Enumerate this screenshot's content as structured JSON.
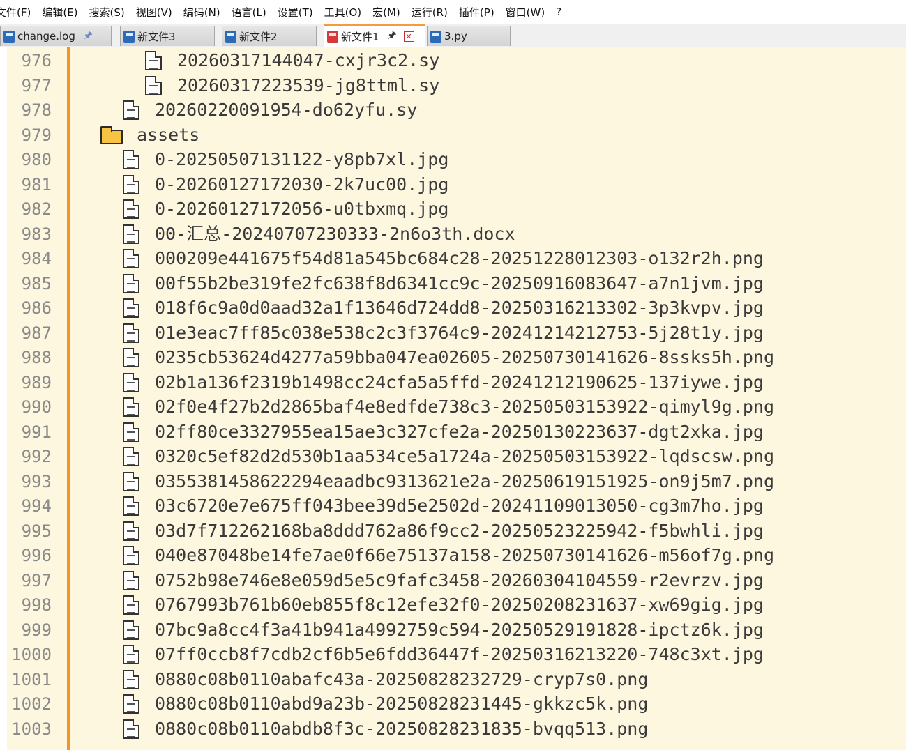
{
  "menu": [
    "文件(F)",
    "编辑(E)",
    "搜索(S)",
    "视图(V)",
    "编码(N)",
    "语言(L)",
    "设置(T)",
    "工具(O)",
    "宏(M)",
    "运行(R)",
    "插件(P)",
    "窗口(W)",
    "?"
  ],
  "tabs": [
    {
      "label": "change.log",
      "active": false
    },
    {
      "label": "新文件3",
      "active": false
    },
    {
      "label": "新文件2",
      "active": false
    },
    {
      "label": "新文件1",
      "active": true
    },
    {
      "label": "3.py",
      "active": false
    }
  ],
  "lines": [
    {
      "number": "976",
      "kind": "file",
      "depth": 3,
      "text": "20260317144047-cxjr3c2.sy"
    },
    {
      "number": "977",
      "kind": "file",
      "depth": 3,
      "text": "20260317223539-jg8ttml.sy"
    },
    {
      "number": "978",
      "kind": "file",
      "depth": 2,
      "text": "20260220091954-do62yfu.sy"
    },
    {
      "number": "979",
      "kind": "folder",
      "depth": 1,
      "text": "assets"
    },
    {
      "number": "980",
      "kind": "file",
      "depth": 2,
      "text": "0-20250507131122-y8pb7xl.jpg"
    },
    {
      "number": "981",
      "kind": "file",
      "depth": 2,
      "text": "0-20260127172030-2k7uc00.jpg"
    },
    {
      "number": "982",
      "kind": "file",
      "depth": 2,
      "text": "0-20260127172056-u0tbxmq.jpg"
    },
    {
      "number": "983",
      "kind": "file",
      "depth": 2,
      "text": "00-汇总-20240707230333-2n6o3th.docx"
    },
    {
      "number": "984",
      "kind": "file",
      "depth": 2,
      "text": "000209e441675f54d81a545bc684c28-20251228012303-o132r2h.png"
    },
    {
      "number": "985",
      "kind": "file",
      "depth": 2,
      "text": "00f55b2be319fe2fc638f8d6341cc9c-20250916083647-a7n1jvm.jpg"
    },
    {
      "number": "986",
      "kind": "file",
      "depth": 2,
      "text": "018f6c9a0d0aad32a1f13646d724dd8-20250316213302-3p3kvpv.jpg"
    },
    {
      "number": "987",
      "kind": "file",
      "depth": 2,
      "text": "01e3eac7ff85c038e538c2c3f3764c9-20241214212753-5j28t1y.jpg"
    },
    {
      "number": "988",
      "kind": "file",
      "depth": 2,
      "text": "0235cb53624d4277a59bba047ea02605-20250730141626-8ssks5h.png"
    },
    {
      "number": "989",
      "kind": "file",
      "depth": 2,
      "text": "02b1a136f2319b1498cc24cfa5a5ffd-20241212190625-137iywe.jpg"
    },
    {
      "number": "990",
      "kind": "file",
      "depth": 2,
      "text": "02f0e4f27b2d2865baf4e8edfde738c3-20250503153922-qimyl9g.png"
    },
    {
      "number": "991",
      "kind": "file",
      "depth": 2,
      "text": "02ff80ce3327955ea15ae3c327cfe2a-20250130223637-dgt2xka.jpg"
    },
    {
      "number": "992",
      "kind": "file",
      "depth": 2,
      "text": "0320c5ef82d2d530b1aa534ce5a1724a-20250503153922-lqdscsw.png"
    },
    {
      "number": "993",
      "kind": "file",
      "depth": 2,
      "text": "0355381458622294eaadbc9313621e2a-20250619151925-on9j5m7.png"
    },
    {
      "number": "994",
      "kind": "file",
      "depth": 2,
      "text": "03c6720e7e675ff043bee39d5e2502d-20241109013050-cg3m7ho.jpg"
    },
    {
      "number": "995",
      "kind": "file",
      "depth": 2,
      "text": "03d7f712262168ba8ddd762a86f9cc2-20250523225942-f5bwhli.jpg"
    },
    {
      "number": "996",
      "kind": "file",
      "depth": 2,
      "text": "040e87048be14fe7ae0f66e75137a158-20250730141626-m56of7g.png"
    },
    {
      "number": "997",
      "kind": "file",
      "depth": 2,
      "text": "0752b98e746e8e059d5e5c9fafc3458-20260304104559-r2evrzv.jpg"
    },
    {
      "number": "998",
      "kind": "file",
      "depth": 2,
      "text": "0767993b761b60eb855f8c12efe32f0-20250208231637-xw69gig.jpg"
    },
    {
      "number": "999",
      "kind": "file",
      "depth": 2,
      "text": "07bc9a8cc4f3a41b941a4992759c594-20250529191828-ipctz6k.jpg"
    },
    {
      "number": "1000",
      "kind": "file",
      "depth": 2,
      "text": "07ff0ccb8f7cdb2cf6b5e6fdd36447f-20250316213220-748c3xt.jpg"
    },
    {
      "number": "1001",
      "kind": "file",
      "depth": 2,
      "text": "0880c08b0110abafc43a-20250828232729-cryp7s0.png"
    },
    {
      "number": "1002",
      "kind": "file",
      "depth": 2,
      "text": "0880c08b0110abd9a23b-20250828231445-gkkzc5k.png"
    },
    {
      "number": "1003",
      "kind": "file",
      "depth": 2,
      "text": "0880c08b0110abdb8f3c-20250828231835-bvqq513.png"
    }
  ],
  "colors": {
    "editor_bg": "#fef7e0",
    "margin_bar": "#f7941d",
    "active_tab_accent": "#f79a3b"
  }
}
